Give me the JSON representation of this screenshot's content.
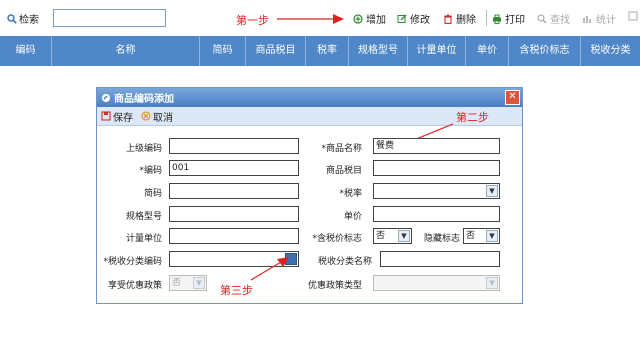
{
  "toolbar": {
    "search_label": "检索",
    "search_value": "",
    "buttons": {
      "add": "增加",
      "edit": "修改",
      "delete": "删除",
      "print": "打印",
      "find": "查找",
      "stats": "统计",
      "more": "图"
    }
  },
  "annotations": {
    "step1": "第一步",
    "step2": "第二步",
    "step3": "第三步"
  },
  "grid": {
    "columns": [
      "编码",
      "名称",
      "简码",
      "商品税目",
      "税率",
      "规格型号",
      "计量单位",
      "单价",
      "含税价标志",
      "税收分类"
    ]
  },
  "dialog": {
    "title": "商品编码添加",
    "save": "保存",
    "cancel": "取消",
    "fields": {
      "parent_code": {
        "label": "上级编码",
        "value": ""
      },
      "product_name": {
        "label": "*商品名称",
        "value": "餐费"
      },
      "code": {
        "label": "*编码",
        "value": "001"
      },
      "product_tax_item": {
        "label": "商品税目",
        "value": ""
      },
      "short_code": {
        "label": "简码",
        "value": ""
      },
      "tax_rate": {
        "label": "*税率",
        "value": ""
      },
      "spec": {
        "label": "规格型号",
        "value": ""
      },
      "unit_price": {
        "label": "单价",
        "value": ""
      },
      "unit": {
        "label": "计量单位",
        "value": ""
      },
      "tax_inclusive": {
        "label": "*含税价标志",
        "value": "否"
      },
      "hidden_flag": {
        "label": "隐藏标志",
        "value": "否"
      },
      "tax_class_code": {
        "label": "*税收分类编码",
        "value": ""
      },
      "tax_class_name": {
        "label": "税收分类名称",
        "value": ""
      },
      "preferential": {
        "label": "享受优惠政策",
        "value": "否"
      },
      "preferential_type": {
        "label": "优惠政策类型",
        "value": ""
      }
    }
  },
  "colors": {
    "header": "#4f87c9",
    "annotation": "#dd2222",
    "dialog_title": "#4a7fc2"
  }
}
